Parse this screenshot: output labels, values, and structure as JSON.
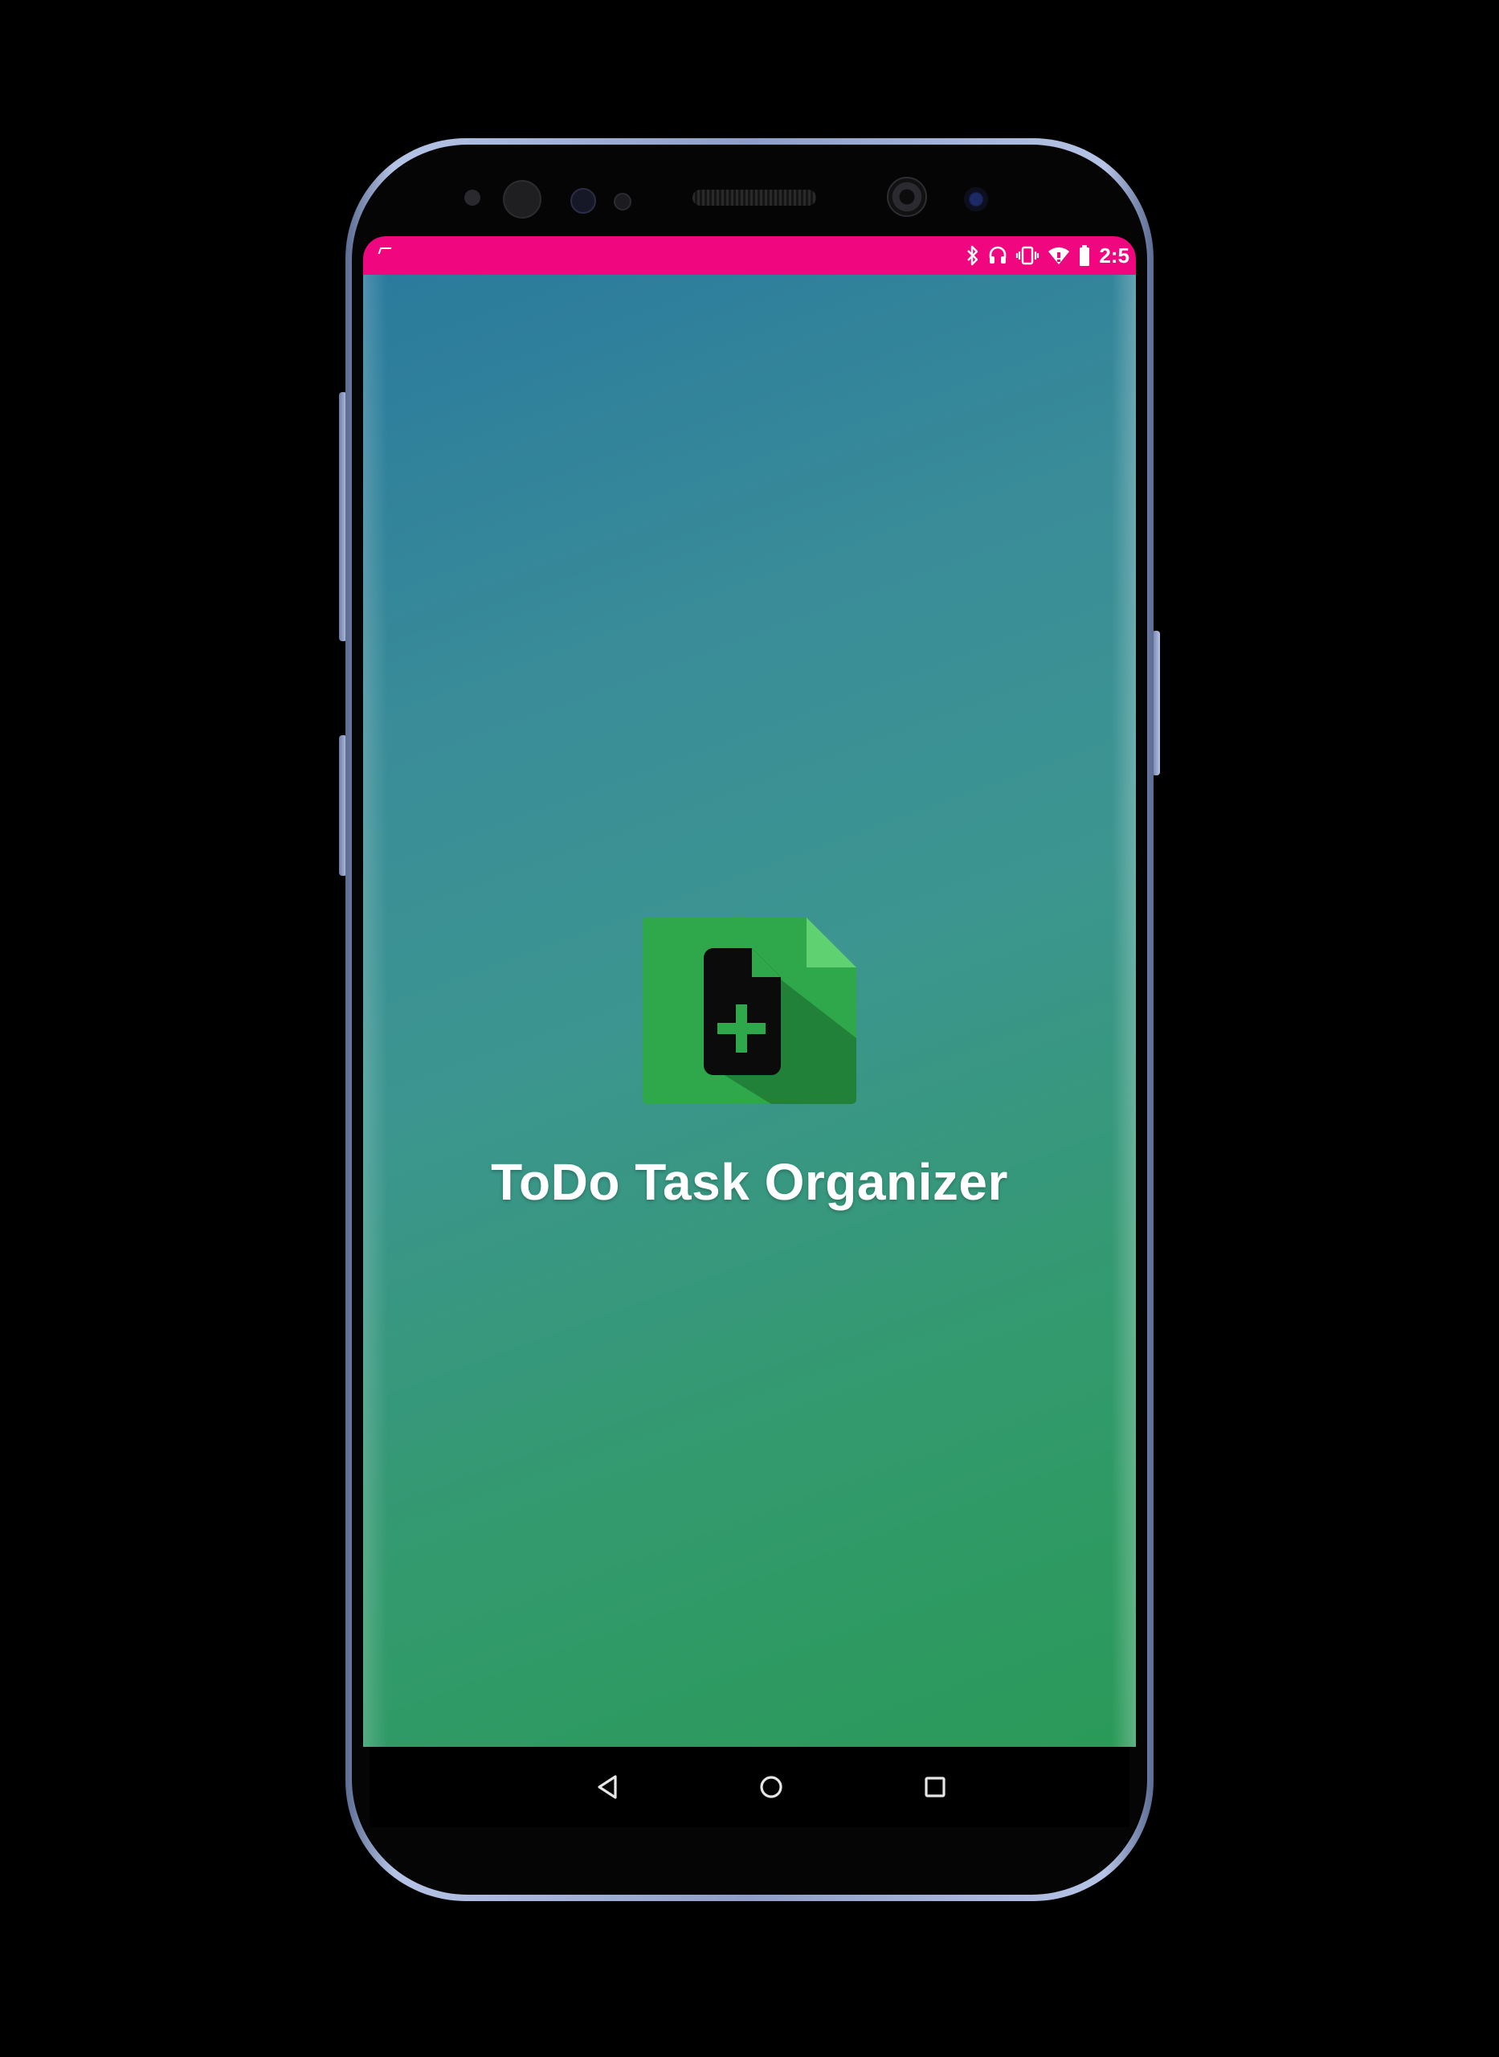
{
  "status_bar": {
    "background": "#f0077f",
    "icons": [
      "bluetooth-icon",
      "headset-icon",
      "vibrate-icon",
      "wifi-icon",
      "battery-icon"
    ],
    "time": "2:5"
  },
  "splash": {
    "app_name": "ToDo Task Organizer",
    "icon": "note-add-icon",
    "gradient_colors": [
      "#2a7a9d",
      "#3c9590",
      "#2a9a58"
    ],
    "icon_colors": {
      "sheet": "#2ea84a",
      "fold": "#5fd170",
      "shadow": "#1f7a35",
      "doc": "#0b0b0b",
      "plus": "#2ea84a"
    }
  },
  "navigation": {
    "buttons": [
      "back",
      "home",
      "recents"
    ]
  }
}
